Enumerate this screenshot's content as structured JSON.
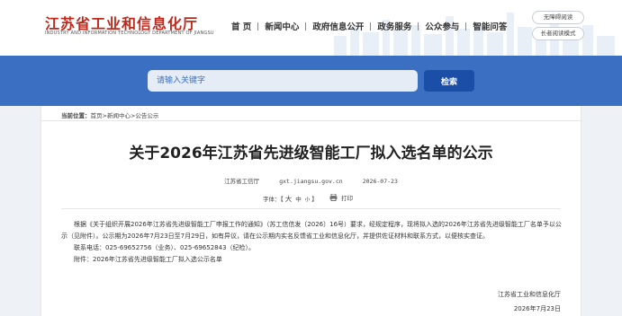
{
  "header": {
    "logo_cn": "江苏省工业和信息化厅",
    "logo_en": "INDUSTRY AND INFORMATION TECHNOLOGY DEPARTMENT OF JIANGSU",
    "nav": [
      "首 页",
      "新闻中心",
      "政府信息公开",
      "政务服务",
      "公众参与",
      "智能问答"
    ],
    "tools": [
      "无障碍阅读",
      "长者阅读模式"
    ]
  },
  "search": {
    "placeholder": "请输入关键字",
    "button": "检索"
  },
  "breadcrumb": {
    "label": "当前位置：",
    "items": [
      "首页",
      "新闻中心",
      "公告公示"
    ],
    "sep": ">"
  },
  "article": {
    "title": "关于2026年江苏省先进级智能工厂拟入选名单的公示",
    "source": "江苏省工信厅",
    "site": "gxt.jiangsu.gov.cn",
    "date": "2026-07-23",
    "fontsize_label": "字体：",
    "fontsize_open": "【",
    "fontsize_big": "大",
    "fontsize_mid": "中",
    "fontsize_small": "小",
    "fontsize_close": "】",
    "print": "打印",
    "para1": "根据《关于组织开展2026年江苏省先进级智能工厂申报工作的通知》（苏工信信发〔2026〕16号）要求，经规定程序，现将拟入选的2026年江苏省先进级智能工厂名单予以公示（见附件）。公示期为2026年7月23日至7月29日，如有异议，请在公示期内实名反馈省工业和信息化厅，并提供佐证材料和联系方式，以便核实查证。",
    "contact": "联系电话：025-69652756（业务）、025-69652843（纪检）。",
    "attachment_label": "附件：",
    "attachment": "2026年江苏省先进级智能工厂拟入选公示名单",
    "sign_org": "江苏省工业和信息化厅",
    "sign_date": "2026年7月23日"
  },
  "colors": {
    "brand_red": "#c0281c",
    "banner_blue": "#3b6fc1",
    "button_blue": "#1b4ea6"
  }
}
